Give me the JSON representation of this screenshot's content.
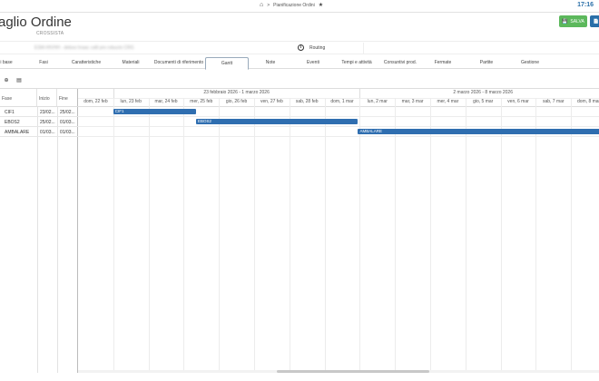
{
  "header": {
    "breadcrumb_home_icon": "home-icon",
    "breadcrumb_sep": ">",
    "breadcrumb_page": "Pianificazione Ordini",
    "breadcrumb_star": "★",
    "clock": "17:16"
  },
  "order": {
    "title": "aglio Ordine",
    "status": "CROSSISTA",
    "description": "ESM-HIVHH - deboo hraac calli pro robucto CRG",
    "info_icon": "i",
    "routing_label": "Routing"
  },
  "actions": {
    "save_label": "SALVA",
    "save_icon": "💾",
    "extra_icon": "📄"
  },
  "tabs": [
    {
      "label": "i base"
    },
    {
      "label": "Fasi"
    },
    {
      "label": "Caratteristiche"
    },
    {
      "label": "Materiali"
    },
    {
      "label": "Documenti di riferimento"
    },
    {
      "label": "Gantt"
    },
    {
      "label": "Note"
    },
    {
      "label": "Eventi"
    },
    {
      "label": "Tempi e attività"
    },
    {
      "label": "Consuntivi prod."
    },
    {
      "label": "Fermate"
    },
    {
      "label": "Partite"
    },
    {
      "label": "Gestione"
    }
  ],
  "active_tab": "Gantt",
  "toolbar": {
    "zoom_icon": "🔍",
    "export_icon": "▤"
  },
  "grid": {
    "columns": [
      "Fase",
      "Inizio",
      "Fine"
    ],
    "rows": [
      {
        "fase": "CIF1",
        "inizio": "23/02...",
        "fine": "25/02..."
      },
      {
        "fase": "EBOS2",
        "inizio": "25/02...",
        "fine": "01/03..."
      },
      {
        "fase": "AMBALARE",
        "inizio": "01/03...",
        "fine": "01/03..."
      }
    ]
  },
  "gantt": {
    "weeks": [
      "23 febbraio 2026 - 1 marzo 2026",
      "2 marzo 2026 - 8 marzo 2026"
    ],
    "days": [
      "dom, 22 feb",
      "lun, 23 feb",
      "mar, 24 feb",
      "mer, 25 feb",
      "gio, 26 feb",
      "ven, 27 feb",
      "sab, 28 feb",
      "dom, 1 mar",
      "lun, 2 mar",
      "mar, 3 mar",
      "mer, 4 mar",
      "gio, 5 mar",
      "ven, 6 mar",
      "sab, 7 mar",
      "dom, 8 mar"
    ],
    "tasks": [
      {
        "label": "CIF1",
        "start_day": 1.0,
        "end_day": 3.35
      },
      {
        "label": "EBOS2",
        "start_day": 3.35,
        "end_day": 7.95
      },
      {
        "label": "AMBALARE",
        "start_day": 7.95,
        "end_day": 15.0
      }
    ],
    "bar_color": "#2f6eb0"
  }
}
